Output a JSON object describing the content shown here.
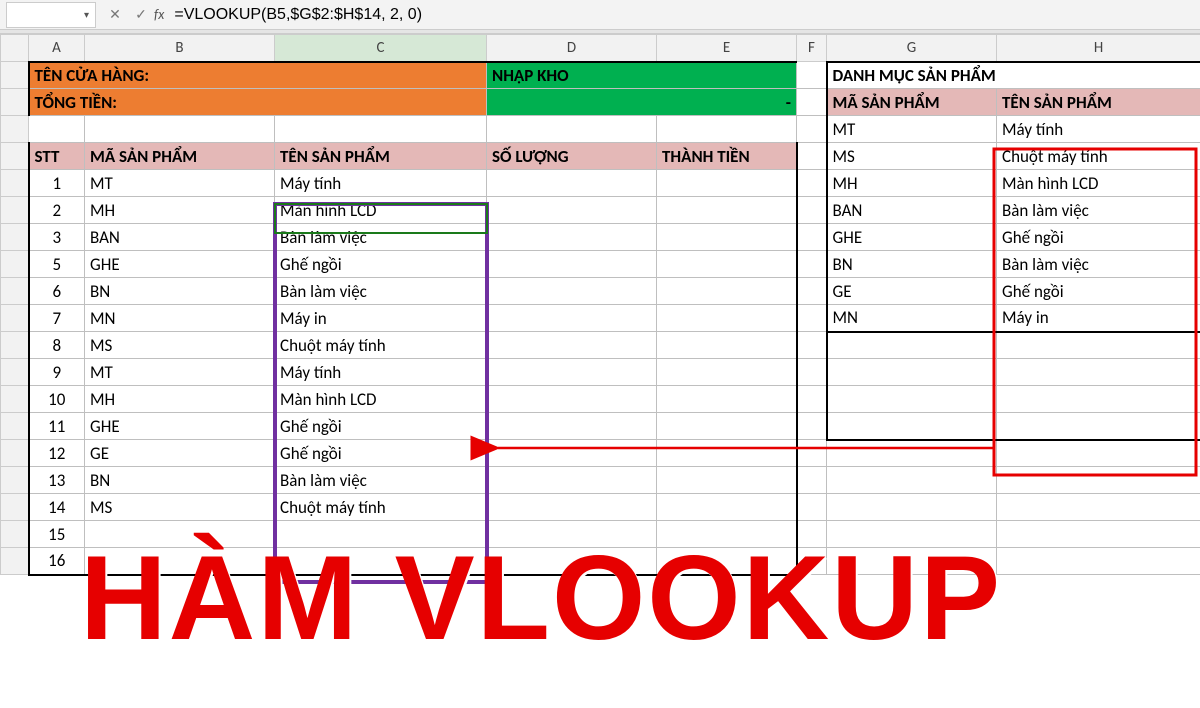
{
  "namebox": "",
  "formula": "=VLOOKUP(B5,$G$2:$H$14, 2, 0)",
  "fx_label": "fx",
  "cols": {
    "A": "A",
    "B": "B",
    "C": "C",
    "D": "D",
    "E": "E",
    "F": "F",
    "G": "G",
    "H": "H"
  },
  "top": {
    "store_label": "TÊN CỬA HÀNG:",
    "total_label": "TỔNG TIỀN:",
    "import_label": "NHẬP KHO",
    "dash": "-",
    "catalog_label": "DANH MỤC SẢN PHẨM"
  },
  "headers": {
    "stt": "STT",
    "code": "MÃ SẢN PHẨM",
    "name": "TÊN SẢN PHẨM",
    "qty": "SỐ LƯỢNG",
    "total": "THÀNH TIỀN",
    "cat_code": "MÃ SẢN PHẨM",
    "cat_name": "TÊN SẢN PHẨM"
  },
  "left": [
    {
      "stt": "1",
      "code": "MT",
      "name": "Máy tính"
    },
    {
      "stt": "2",
      "code": "MH",
      "name": "Màn hình LCD"
    },
    {
      "stt": "3",
      "code": "BAN",
      "name": "Bàn làm việc"
    },
    {
      "stt": "5",
      "code": "GHE",
      "name": "Ghế ngồi"
    },
    {
      "stt": "6",
      "code": "BN",
      "name": "Bàn làm việc"
    },
    {
      "stt": "7",
      "code": "MN",
      "name": "Máy in"
    },
    {
      "stt": "8",
      "code": "MS",
      "name": "Chuột máy tính"
    },
    {
      "stt": "9",
      "code": "MT",
      "name": "Máy tính"
    },
    {
      "stt": "10",
      "code": "MH",
      "name": "Màn hình LCD"
    },
    {
      "stt": "11",
      "code": "GHE",
      "name": "Ghế ngồi"
    },
    {
      "stt": "12",
      "code": "GE",
      "name": "Ghế ngồi"
    },
    {
      "stt": "13",
      "code": "BN",
      "name": "Bàn làm việc"
    },
    {
      "stt": "14",
      "code": "MS",
      "name": "Chuột máy tính"
    }
  ],
  "catalog": [
    {
      "code": "MT",
      "name": "Máy tính"
    },
    {
      "code": "MS",
      "name": "Chuột máy tính"
    },
    {
      "code": "MH",
      "name": "Màn hình LCD"
    },
    {
      "code": "BAN",
      "name": "Bàn làm việc"
    },
    {
      "code": "GHE",
      "name": "Ghế ngồi"
    },
    {
      "code": "BN",
      "name": "Bàn làm việc"
    },
    {
      "code": "GE",
      "name": "Ghế ngồi"
    },
    {
      "code": "MN",
      "name": "Máy in"
    }
  ],
  "extra_rows": [
    "15",
    "16"
  ],
  "overlay": "HÀM VLOOKUP"
}
